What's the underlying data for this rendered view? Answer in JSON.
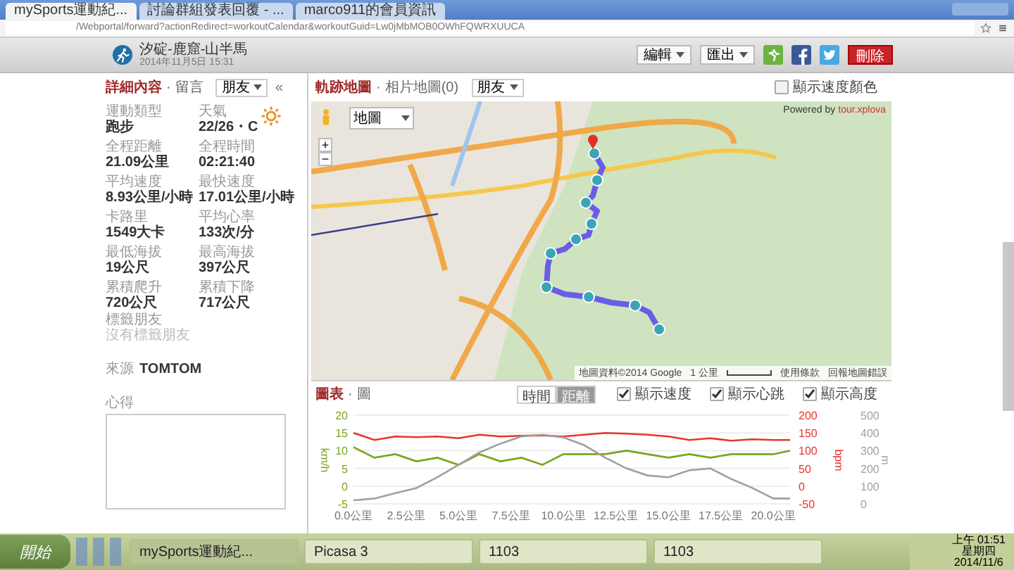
{
  "browser": {
    "tabs": [
      {
        "title": "mySports運動紀...",
        "selected": true
      },
      {
        "title": "討論群組發表回覆 - ...",
        "selected": false
      },
      {
        "title": "marco911的會員資訊",
        "selected": false
      }
    ],
    "url": "/Webportal/forward?actionRedirect=workoutCalendar&workoutGuid=Lw0jMbMOB0OWhFQWRXUUCA"
  },
  "header": {
    "title": "汐碇-鹿窟-山半馬",
    "date": "2014年11月5日 15:31",
    "edit": "編輯",
    "export": "匯出",
    "delete": "刪除"
  },
  "details": {
    "tabs": [
      {
        "label": "詳細內容",
        "selected": true
      },
      {
        "label": "留言",
        "selected": false
      }
    ],
    "separator": "·",
    "privacy": "朋友",
    "collapse": "«",
    "stats": [
      {
        "label": "運動類型",
        "value": "跑步"
      },
      {
        "label": "天氣",
        "value": "22/26・C"
      },
      {
        "label": "全程距離",
        "value": "21.09公里"
      },
      {
        "label": "全程時間",
        "value": "02:21:40"
      },
      {
        "label": "平均速度",
        "value": "8.93公里/小時"
      },
      {
        "label": "最快速度",
        "value": "17.01公里/小時"
      },
      {
        "label": "卡路里",
        "value": "1549大卡"
      },
      {
        "label": "平均心率",
        "value": "133次/分"
      },
      {
        "label": "最低海拔",
        "value": "19公尺"
      },
      {
        "label": "最高海拔",
        "value": "397公尺"
      },
      {
        "label": "累積爬升",
        "value": "720公尺"
      },
      {
        "label": "累積下降",
        "value": "717公尺"
      }
    ],
    "tagged_label": "標籤朋友",
    "tagged_value": "沒有標籤朋友",
    "source_label": "來源",
    "source": "TOMTOM",
    "notes_label": "心得"
  },
  "map": {
    "tabs": [
      {
        "label": "軌跡地圖",
        "selected": true
      },
      {
        "label": "相片地圖(0)",
        "selected": false
      }
    ],
    "separator": "·",
    "privacy": "朋友",
    "speed_color": {
      "label": "顯示速度顏色",
      "checked": false
    },
    "map_type": "地圖",
    "zoom_in": "+",
    "zoom_out": "−",
    "powered_by": "Powered by",
    "powered_link": "tour.xplova",
    "attribution": "地圖資料©2014 Google",
    "scale": "1 公里",
    "terms": "使用條款",
    "report": "回報地圖錯誤"
  },
  "chart": {
    "tabs": [
      {
        "label": "圖表",
        "selected": true
      },
      {
        "label": "圖",
        "selected": false
      }
    ],
    "separator": "·",
    "modes": [
      {
        "label": "時間",
        "selected": false
      },
      {
        "label": "距離",
        "selected": true
      }
    ],
    "toggles": [
      {
        "label": "顯示速度",
        "checked": true
      },
      {
        "label": "顯示心跳",
        "checked": true
      },
      {
        "label": "顯示高度",
        "checked": true
      }
    ],
    "speed": {
      "chart_data": {
        "type": "line",
        "grid": true,
        "ylabel": "km/h",
        "x": [
          0,
          1,
          2,
          3,
          4,
          5,
          6,
          7,
          8,
          9,
          10,
          11,
          12,
          13,
          14,
          15,
          16,
          17,
          18,
          19,
          20,
          20.8
        ],
        "xlim": [
          0,
          20.8
        ],
        "xticks": [
          {
            "value": 0,
            "label": "0.0公里"
          },
          {
            "value": 2.5,
            "label": "2.5公里"
          },
          {
            "value": 5,
            "label": "5.0公里"
          },
          {
            "value": 7.5,
            "label": "7.5公里"
          },
          {
            "value": 10,
            "label": "10.0公里"
          },
          {
            "value": 12.5,
            "label": "12.5公里"
          },
          {
            "value": 15,
            "label": "15.0公里"
          },
          {
            "value": 17.5,
            "label": "17.5公里"
          },
          {
            "value": 20,
            "label": "20.0公里"
          }
        ],
        "ylim": [
          -5,
          20
        ],
        "yticks": [
          20,
          15,
          10,
          5,
          0,
          -5
        ],
        "series": [
          {
            "color": "#7aa51c",
            "values": [
              11,
              8,
              9,
              7,
              8,
              6,
              9,
              7,
              8,
              6,
              9,
              9,
              9,
              10,
              9,
              8,
              9,
              8,
              9,
              9,
              9,
              10
            ]
          }
        ]
      }
    },
    "heart_rate": {
      "chart_data": {
        "type": "line",
        "ylabel": "bpm",
        "x": [
          0,
          1,
          2,
          3,
          4,
          5,
          6,
          7,
          8,
          9,
          10,
          11,
          12,
          13,
          14,
          15,
          16,
          17,
          18,
          19,
          20,
          20.8
        ],
        "xlim": [
          0,
          20.8
        ],
        "ylim": [
          -50,
          200
        ],
        "yticks": [
          200,
          150,
          100,
          50,
          0,
          -50
        ],
        "series": [
          {
            "color": "#e8352b",
            "values": [
              150,
              130,
              140,
              138,
              140,
              135,
              145,
              140,
              142,
              143,
              140,
              145,
              150,
              148,
              145,
              140,
              130,
              135,
              128,
              132,
              130,
              130
            ]
          }
        ]
      }
    },
    "altitude": {
      "chart_data": {
        "type": "line",
        "ylabel": "m",
        "x": [
          0,
          1,
          2,
          3,
          4,
          5,
          6,
          7,
          8,
          9,
          10,
          11,
          12,
          13,
          14,
          15,
          16,
          17,
          18,
          19,
          20,
          20.8
        ],
        "xlim": [
          0,
          20.8
        ],
        "ylim": [
          0,
          500
        ],
        "yticks": [
          500,
          400,
          300,
          200,
          100,
          0
        ],
        "series": [
          {
            "color": "#a0a0a0",
            "values": [
              20,
              30,
              60,
              90,
              150,
              220,
              290,
              340,
              380,
              390,
              375,
              330,
              260,
              200,
              160,
              150,
              190,
              200,
              140,
              90,
              30,
              30
            ]
          }
        ]
      }
    }
  },
  "taskbar": {
    "start": "開始",
    "windows": [
      {
        "title": "mySports運動紀...",
        "selected": true
      },
      {
        "title": "Picasa 3",
        "selected": false
      },
      {
        "title": "1103",
        "selected": false
      },
      {
        "title": "1103",
        "selected": false
      }
    ],
    "time": "上午 01:51",
    "weekday": "星期四",
    "date": "2014/11/6"
  }
}
